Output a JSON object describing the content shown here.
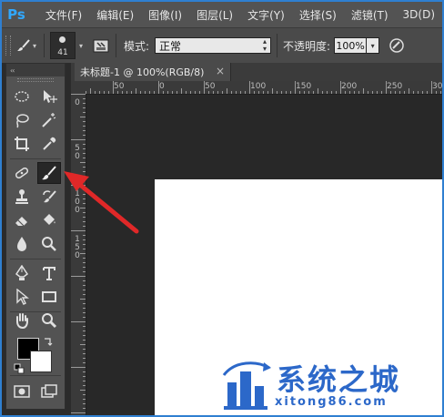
{
  "app": {
    "logo": "Ps"
  },
  "menu": {
    "items": [
      "文件(F)",
      "编辑(E)",
      "图像(I)",
      "图层(L)",
      "文字(Y)",
      "选择(S)",
      "滤镜(T)",
      "3D(D)"
    ]
  },
  "options": {
    "brush_size": "41",
    "mode_label": "模式:",
    "mode_value": "正常",
    "opacity_label": "不透明度:",
    "opacity_value": "100%"
  },
  "toolbox": {
    "collapse_glyph": "‹‹"
  },
  "document": {
    "tab_title": "未标题-1 @ 100%(RGB/8)",
    "close_glyph": "×"
  },
  "rulers": {
    "h_labels": [
      "50",
      "0",
      "50",
      "100",
      "150",
      "200",
      "250",
      "300"
    ],
    "v_labels": [
      "0",
      "5",
      "0",
      "1",
      "0",
      "0",
      "1",
      "5",
      "0"
    ]
  },
  "watermark": {
    "title": "系统之城",
    "site": "xitong86.com"
  },
  "colors": {
    "foreground": "#000000",
    "background": "#ffffff",
    "arrow": "#e02828",
    "watermark": "#2c68c9"
  },
  "icons": {
    "toolbox": [
      "marquee-icon",
      "move-icon",
      "lasso-icon",
      "magic-wand-icon",
      "crop-icon",
      "eyedropper-icon",
      "healing-brush-icon",
      "brush-icon",
      "clone-stamp-icon",
      "history-brush-icon",
      "eraser-icon",
      "paint-bucket-icon",
      "blur-icon",
      "dodge-icon",
      "pen-icon",
      "type-icon",
      "path-select-icon",
      "rectangle-icon",
      "hand-icon",
      "zoom-icon"
    ]
  }
}
